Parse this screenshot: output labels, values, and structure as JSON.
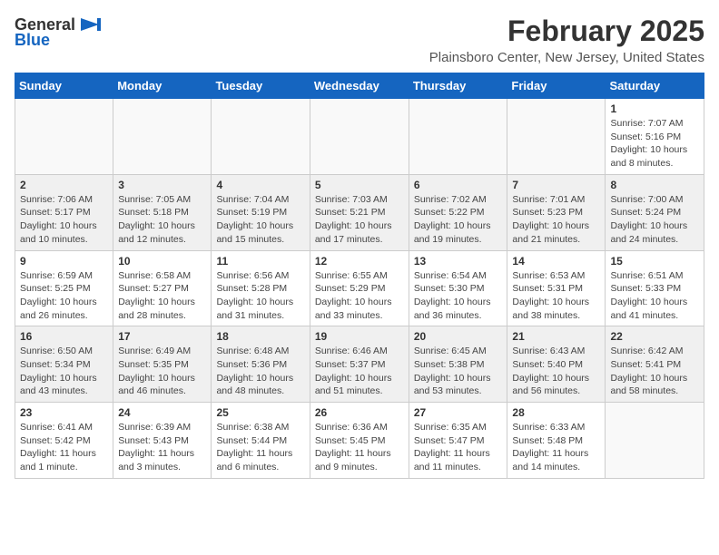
{
  "logo": {
    "text_general": "General",
    "text_blue": "Blue",
    "arrow_symbol": "▶"
  },
  "header": {
    "title": "February 2025",
    "subtitle": "Plainsboro Center, New Jersey, United States"
  },
  "weekdays": [
    "Sunday",
    "Monday",
    "Tuesday",
    "Wednesday",
    "Thursday",
    "Friday",
    "Saturday"
  ],
  "weeks": [
    [
      {
        "day": "",
        "info": ""
      },
      {
        "day": "",
        "info": ""
      },
      {
        "day": "",
        "info": ""
      },
      {
        "day": "",
        "info": ""
      },
      {
        "day": "",
        "info": ""
      },
      {
        "day": "",
        "info": ""
      },
      {
        "day": "1",
        "info": "Sunrise: 7:07 AM\nSunset: 5:16 PM\nDaylight: 10 hours and 8 minutes."
      }
    ],
    [
      {
        "day": "2",
        "info": "Sunrise: 7:06 AM\nSunset: 5:17 PM\nDaylight: 10 hours and 10 minutes."
      },
      {
        "day": "3",
        "info": "Sunrise: 7:05 AM\nSunset: 5:18 PM\nDaylight: 10 hours and 12 minutes."
      },
      {
        "day": "4",
        "info": "Sunrise: 7:04 AM\nSunset: 5:19 PM\nDaylight: 10 hours and 15 minutes."
      },
      {
        "day": "5",
        "info": "Sunrise: 7:03 AM\nSunset: 5:21 PM\nDaylight: 10 hours and 17 minutes."
      },
      {
        "day": "6",
        "info": "Sunrise: 7:02 AM\nSunset: 5:22 PM\nDaylight: 10 hours and 19 minutes."
      },
      {
        "day": "7",
        "info": "Sunrise: 7:01 AM\nSunset: 5:23 PM\nDaylight: 10 hours and 21 minutes."
      },
      {
        "day": "8",
        "info": "Sunrise: 7:00 AM\nSunset: 5:24 PM\nDaylight: 10 hours and 24 minutes."
      }
    ],
    [
      {
        "day": "9",
        "info": "Sunrise: 6:59 AM\nSunset: 5:25 PM\nDaylight: 10 hours and 26 minutes."
      },
      {
        "day": "10",
        "info": "Sunrise: 6:58 AM\nSunset: 5:27 PM\nDaylight: 10 hours and 28 minutes."
      },
      {
        "day": "11",
        "info": "Sunrise: 6:56 AM\nSunset: 5:28 PM\nDaylight: 10 hours and 31 minutes."
      },
      {
        "day": "12",
        "info": "Sunrise: 6:55 AM\nSunset: 5:29 PM\nDaylight: 10 hours and 33 minutes."
      },
      {
        "day": "13",
        "info": "Sunrise: 6:54 AM\nSunset: 5:30 PM\nDaylight: 10 hours and 36 minutes."
      },
      {
        "day": "14",
        "info": "Sunrise: 6:53 AM\nSunset: 5:31 PM\nDaylight: 10 hours and 38 minutes."
      },
      {
        "day": "15",
        "info": "Sunrise: 6:51 AM\nSunset: 5:33 PM\nDaylight: 10 hours and 41 minutes."
      }
    ],
    [
      {
        "day": "16",
        "info": "Sunrise: 6:50 AM\nSunset: 5:34 PM\nDaylight: 10 hours and 43 minutes."
      },
      {
        "day": "17",
        "info": "Sunrise: 6:49 AM\nSunset: 5:35 PM\nDaylight: 10 hours and 46 minutes."
      },
      {
        "day": "18",
        "info": "Sunrise: 6:48 AM\nSunset: 5:36 PM\nDaylight: 10 hours and 48 minutes."
      },
      {
        "day": "19",
        "info": "Sunrise: 6:46 AM\nSunset: 5:37 PM\nDaylight: 10 hours and 51 minutes."
      },
      {
        "day": "20",
        "info": "Sunrise: 6:45 AM\nSunset: 5:38 PM\nDaylight: 10 hours and 53 minutes."
      },
      {
        "day": "21",
        "info": "Sunrise: 6:43 AM\nSunset: 5:40 PM\nDaylight: 10 hours and 56 minutes."
      },
      {
        "day": "22",
        "info": "Sunrise: 6:42 AM\nSunset: 5:41 PM\nDaylight: 10 hours and 58 minutes."
      }
    ],
    [
      {
        "day": "23",
        "info": "Sunrise: 6:41 AM\nSunset: 5:42 PM\nDaylight: 11 hours and 1 minute."
      },
      {
        "day": "24",
        "info": "Sunrise: 6:39 AM\nSunset: 5:43 PM\nDaylight: 11 hours and 3 minutes."
      },
      {
        "day": "25",
        "info": "Sunrise: 6:38 AM\nSunset: 5:44 PM\nDaylight: 11 hours and 6 minutes."
      },
      {
        "day": "26",
        "info": "Sunrise: 6:36 AM\nSunset: 5:45 PM\nDaylight: 11 hours and 9 minutes."
      },
      {
        "day": "27",
        "info": "Sunrise: 6:35 AM\nSunset: 5:47 PM\nDaylight: 11 hours and 11 minutes."
      },
      {
        "day": "28",
        "info": "Sunrise: 6:33 AM\nSunset: 5:48 PM\nDaylight: 11 hours and 14 minutes."
      },
      {
        "day": "",
        "info": ""
      }
    ]
  ]
}
